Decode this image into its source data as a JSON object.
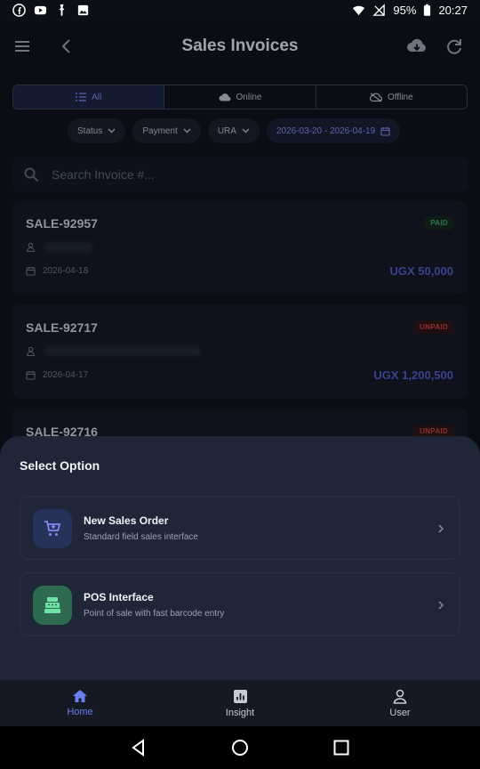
{
  "status_bar": {
    "battery": "95%",
    "time": "20:27",
    "left_icons": [
      "facebook-icon",
      "youtube-icon",
      "notification-icon",
      "image-icon"
    ],
    "right_icons": [
      "wifi-icon",
      "no-signal-icon",
      "battery-icon"
    ]
  },
  "app_bar": {
    "title": "Sales Invoices",
    "icons": [
      "menu-icon",
      "back-arrow-icon",
      "cloud-download-icon",
      "refresh-icon"
    ]
  },
  "segments": [
    {
      "label": "All",
      "icon": "list-icon",
      "active": true
    },
    {
      "label": "Online",
      "icon": "cloud-icon",
      "active": false
    },
    {
      "label": "Offline",
      "icon": "cloud-off-icon",
      "active": false
    }
  ],
  "filters": {
    "status": "Status",
    "payment": "Payment",
    "ura": "URA",
    "date_range": "2026-03-20 - 2026-04-19"
  },
  "search": {
    "placeholder": "Search Invoice #..."
  },
  "invoices": [
    {
      "number": "SALE-92957",
      "status": "PAID",
      "date": "2026-04-18",
      "amount": "UGX 50,000"
    },
    {
      "number": "SALE-92717",
      "status": "UNPAID",
      "date": "2026-04-17",
      "amount": "UGX 1,200,500"
    },
    {
      "number": "SALE-92716",
      "status": "UNPAID"
    }
  ],
  "sheet": {
    "title": "Select Option",
    "options": [
      {
        "title": "New Sales Order",
        "subtitle": "Standard field sales interface",
        "icon": "cart-add-icon",
        "color": "#27325a"
      },
      {
        "title": "POS Interface",
        "subtitle": "Point of sale with fast barcode entry",
        "icon": "cash-register-icon",
        "color": "#2d6a4f"
      }
    ]
  },
  "bottom_nav": [
    {
      "label": "Home",
      "icon": "home-icon",
      "active": true
    },
    {
      "label": "Insight",
      "icon": "insight-chart-icon",
      "active": false
    },
    {
      "label": "User",
      "icon": "user-icon",
      "active": false
    }
  ],
  "colors": {
    "accent": "#6c7ef0",
    "paid": "#3fa764",
    "unpaid": "#c2443c",
    "amount": "#4f5dc4",
    "sheet_bg": "#1e2637"
  }
}
